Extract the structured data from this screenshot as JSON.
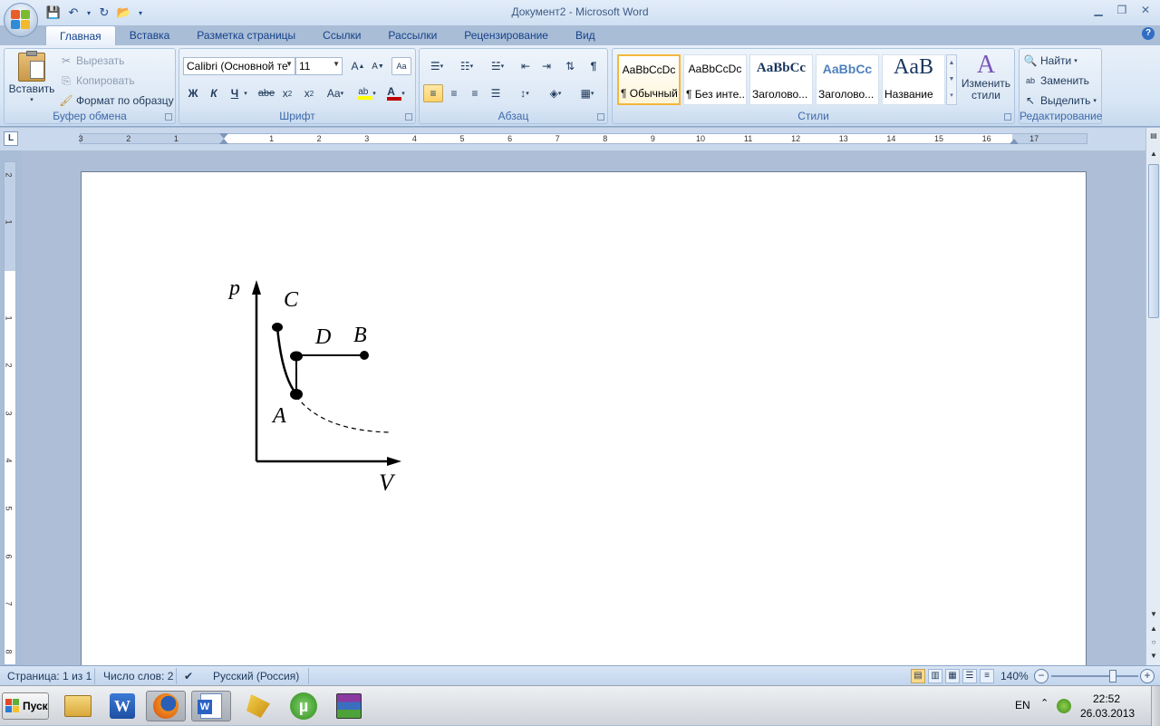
{
  "window": {
    "title": "Документ2 - Microsoft Word"
  },
  "tabs": [
    "Главная",
    "Вставка",
    "Разметка страницы",
    "Ссылки",
    "Рассылки",
    "Рецензирование",
    "Вид"
  ],
  "clipboard": {
    "paste": "Вставить",
    "cut": "Вырезать",
    "copy": "Копировать",
    "format_painter": "Формат по образцу",
    "label": "Буфер обмена"
  },
  "font": {
    "name": "Calibri (Основной те",
    "size": "11",
    "label": "Шрифт",
    "bold": "Ж",
    "italic": "К",
    "underline": "Ч",
    "strike": "abe",
    "case": "Aa"
  },
  "paragraph": {
    "label": "Абзац"
  },
  "styles": {
    "label": "Стили",
    "items": [
      {
        "sample": "AaBbCcDc",
        "name": "¶ Обычный"
      },
      {
        "sample": "AaBbCcDc",
        "name": "¶ Без инте..."
      },
      {
        "sample": "AaBbCc",
        "name": "Заголово..."
      },
      {
        "sample": "AaBbCc",
        "name": "Заголово..."
      },
      {
        "sample": "AaB",
        "name": "Название"
      }
    ],
    "change": "Изменить стили"
  },
  "editing": {
    "label": "Редактирование",
    "find": "Найти",
    "replace": "Заменить",
    "select": "Выделить"
  },
  "ruler": {
    "h_ticks": [
      "3",
      "2",
      "1",
      "1",
      "2",
      "3",
      "4",
      "5",
      "6",
      "7",
      "8",
      "9",
      "10",
      "11",
      "12",
      "13",
      "14",
      "15",
      "16",
      "17"
    ],
    "v_ticks": [
      "2",
      "1",
      "1",
      "2",
      "3",
      "4",
      "5",
      "6",
      "7",
      "8"
    ]
  },
  "figure": {
    "labels": {
      "p": "p",
      "V": "V",
      "A": "A",
      "B": "B",
      "C": "C",
      "D": "D"
    }
  },
  "status": {
    "page": "Страница: 1 из 1",
    "words": "Число слов: 2",
    "language": "Русский (Россия)",
    "zoom": "140%",
    "zoom_level": 0.71
  },
  "taskbar": {
    "start": "Пуск",
    "lang": "EN",
    "time": "22:52",
    "date": "26.03.2013"
  }
}
